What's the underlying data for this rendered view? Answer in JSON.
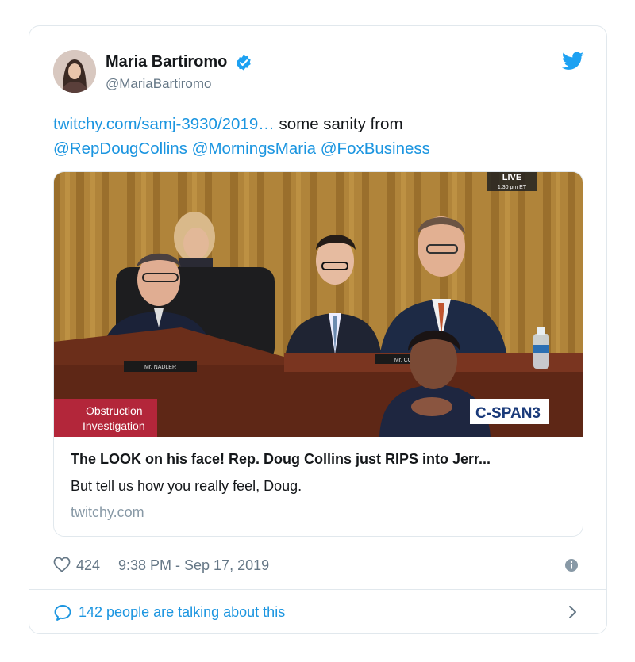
{
  "tweet": {
    "author": {
      "name": "Maria Bartiromo",
      "handle": "@MariaBartiromo",
      "verified": true
    },
    "text": {
      "link_url": "twitchy.com/samj-3930/2019…",
      "plain": " some sanity from ",
      "mention_1": "@RepDougCollins",
      "mention_2": "@MorningsMaria",
      "mention_3": "@FoxBusiness"
    },
    "card": {
      "title": "The LOOK on his face! Rep. Doug Collins just RIPS into Jerr...",
      "description": "But tell us how you really feel, Doug.",
      "domain": "twitchy.com",
      "media": {
        "live_label": "LIVE",
        "live_time": "1:30 pm ET",
        "lower_third_line_1": "Obstruction",
        "lower_third_line_2": "Investigation",
        "network_logo": "C-SPAN3",
        "nameplate_1": "Mr. NADLER",
        "nameplate_2": "Mr. CO"
      }
    },
    "meta": {
      "likes": "424",
      "timestamp": "9:38 PM - Sep 17, 2019"
    },
    "footer": {
      "talking": "142 people are talking about this"
    }
  },
  "colors": {
    "link": "#1b95e0",
    "secondary_text": "#657786",
    "border": "#e1e8ed",
    "lower_third_red": "#b3263a"
  },
  "icons": [
    "verified-badge-icon",
    "twitter-bird-icon",
    "heart-icon",
    "info-icon",
    "speech-bubble-icon",
    "chevron-right-icon"
  ]
}
